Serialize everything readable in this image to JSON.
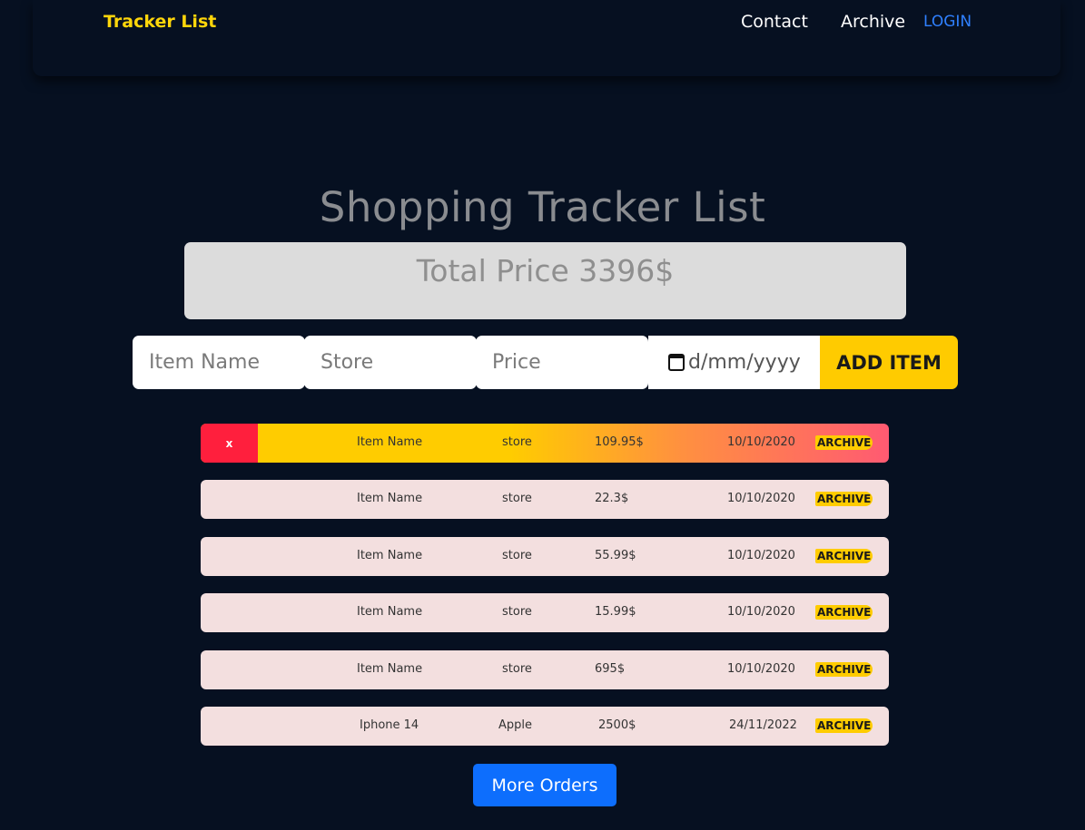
{
  "nav": {
    "brand": "Tracker List",
    "contact": "Contact",
    "archive": "Archive",
    "login": "LOGIN"
  },
  "main": {
    "title": "Shopping Tracker List",
    "total_label": "Total Price 3396$"
  },
  "form": {
    "item_placeholder": "Item Name",
    "store_placeholder": "Store",
    "price_placeholder": "Price",
    "date_placeholder": "d/mm/yyyy",
    "add_label": "ADD ITEM"
  },
  "items": [
    {
      "name": "Item Name",
      "store": "store",
      "price": "109.95$",
      "date": "10/10/2020",
      "archive": "ARCHIVE",
      "delete": "x"
    },
    {
      "name": "Item Name",
      "store": "store",
      "price": "22.3$",
      "date": "10/10/2020",
      "archive": "ARCHIVE"
    },
    {
      "name": "Item Name",
      "store": "store",
      "price": "55.99$",
      "date": "10/10/2020",
      "archive": "ARCHIVE"
    },
    {
      "name": "Item Name",
      "store": "store",
      "price": "15.99$",
      "date": "10/10/2020",
      "archive": "ARCHIVE"
    },
    {
      "name": "Item Name",
      "store": "store",
      "price": "695$",
      "date": "10/10/2020",
      "archive": "ARCHIVE"
    },
    {
      "name": "Iphone 14",
      "store": "Apple",
      "price": "2500$",
      "date": "24/11/2022",
      "archive": "ARCHIVE"
    }
  ],
  "more_orders_label": "More Orders",
  "colors": {
    "background": "#061021",
    "brand": "#ffd60a",
    "accent": "#ffcb00",
    "delete": "#ff1f3d",
    "primary_button": "#0d6efd"
  }
}
